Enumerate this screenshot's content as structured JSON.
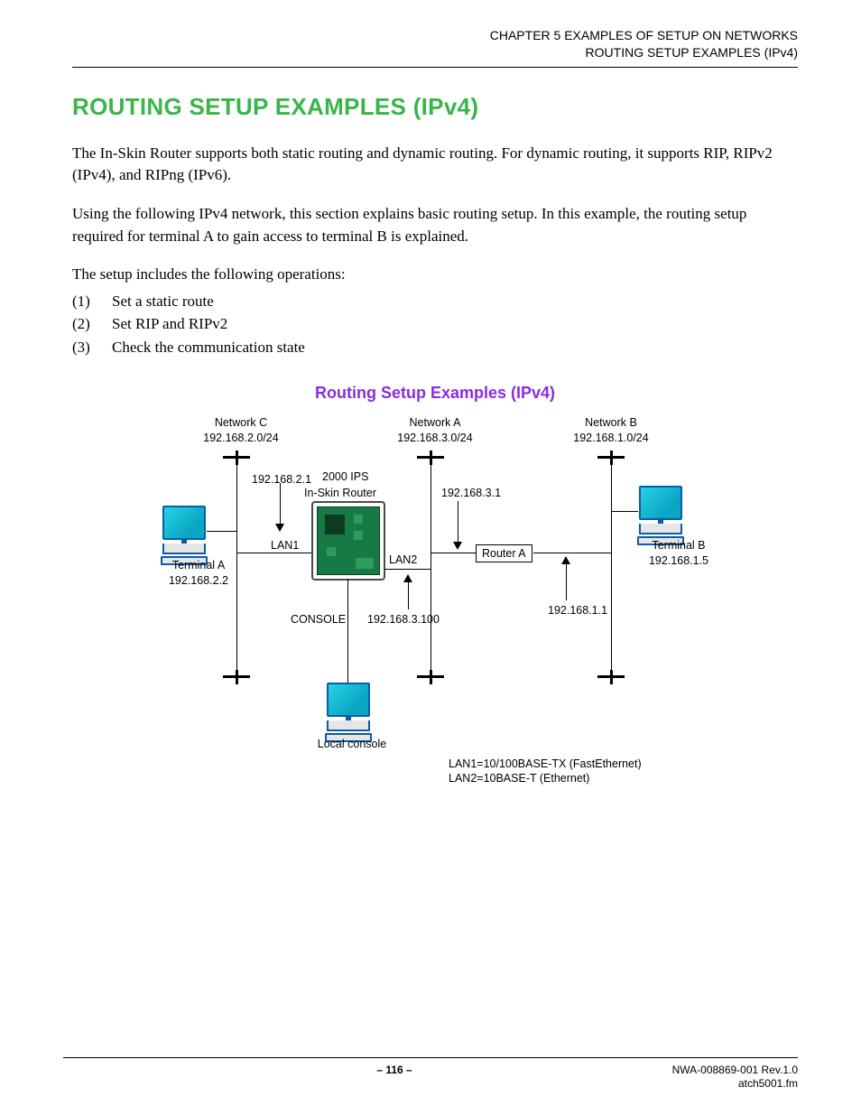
{
  "header": {
    "chapter": "CHAPTER 5   EXAMPLES OF SETUP ON NETWORKS",
    "section": "ROUTING SETUP EXAMPLES (IPv4)"
  },
  "title": "ROUTING SETUP EXAMPLES (IPv4)",
  "paragraphs": {
    "p1": "The In-Skin Router supports both static routing and dynamic routing. For dynamic routing, it supports RIP, RIPv2 (IPv4), and RIPng (IPv6).",
    "p2": "Using the following IPv4 network, this section explains basic routing setup. In this example, the routing setup required for terminal A to gain access to terminal B is explained.",
    "p3": "The setup includes the following operations:"
  },
  "ops": [
    {
      "n": "(1)",
      "t": "Set a static route"
    },
    {
      "n": "(2)",
      "t": "Set RIP and RIPv2"
    },
    {
      "n": "(3)",
      "t": "Check the communication state"
    }
  ],
  "diagram_title": "Routing Setup Examples (IPv4)",
  "diagram": {
    "net_c": {
      "name": "Network C",
      "cidr": "192.168.2.0/24"
    },
    "net_a": {
      "name": "Network A",
      "cidr": "192.168.3.0/24"
    },
    "net_b": {
      "name": "Network B",
      "cidr": "192.168.1.0/24"
    },
    "term_a": {
      "name": "Terminal A",
      "ip": "192.168.2.2"
    },
    "term_b": {
      "name": "Terminal B",
      "ip": "192.168.1.5"
    },
    "ips_label": "2000 IPS",
    "board_label": "In-Skin Router",
    "board_lan1_ip": "192.168.2.1",
    "board_lan2_ip": "192.168.3.100",
    "lan1": "LAN1",
    "lan2": "LAN2",
    "console": "CONSOLE",
    "local_console": "Local console",
    "router_a": {
      "name": "Router A",
      "if_a": "192.168.3.1",
      "if_b": "192.168.1.1"
    },
    "legend1": "LAN1=10/100BASE-TX (FastEthernet)",
    "legend2": "LAN2=10BASE-T (Ethernet)"
  },
  "footer": {
    "page": "– 116 –",
    "doc": "NWA-008869-001 Rev.1.0",
    "file": "atch5001.fm"
  }
}
